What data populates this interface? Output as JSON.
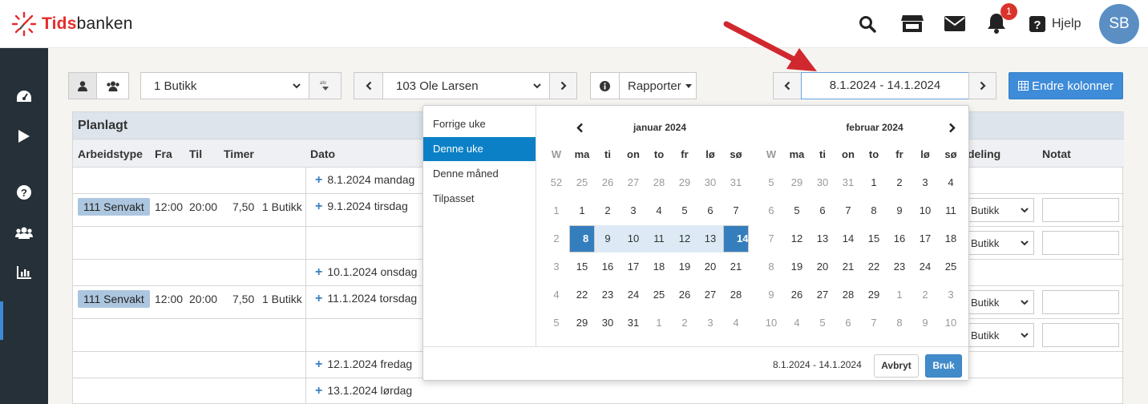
{
  "brand": {
    "name_prefix": "Tids",
    "name_suffix": "banken"
  },
  "topbar": {
    "notification_count": "1",
    "help_label": "Hjelp",
    "avatar_initials": "SB"
  },
  "toolbar": {
    "store_select": "1 Butikk",
    "employee_select": "103 Ole Larsen",
    "reports_label": "Rapporter",
    "date_range": "8.1.2024 - 14.1.2024",
    "edit_columns_label": "Endre kolonner"
  },
  "table": {
    "section_title": "Planlagt",
    "headers": {
      "worktype": "Arbeidstype",
      "from": "Fra",
      "to": "Til",
      "hours": "Timer",
      "date": "Dato",
      "department": "deling",
      "note": "Notat"
    },
    "rows": [
      {
        "date": "8.1.2024 mandag"
      },
      {
        "worktype": "111 Senvakt",
        "from": "12:00",
        "to": "20:00",
        "hours": "7,50",
        "store": "1 Butikk",
        "date": "9.1.2024 tirsdag",
        "dept": "Butikk"
      },
      {
        "dept": "Butikk"
      },
      {
        "date": "10.1.2024 onsdag"
      },
      {
        "worktype": "111 Senvakt",
        "from": "12:00",
        "to": "20:00",
        "hours": "7,50",
        "store": "1 Butikk",
        "date": "11.1.2024 torsdag",
        "dept": "Butikk"
      },
      {
        "dept": "Butikk"
      },
      {
        "date": "12.1.2024 fredag"
      },
      {
        "date": "13.1.2024 lørdag"
      }
    ]
  },
  "picker": {
    "ranges": [
      "Forrige uke",
      "Denne uke",
      "Denne måned",
      "Tilpasset"
    ],
    "active_range": "Denne uke",
    "weekday_headers": [
      "W",
      "ma",
      "ti",
      "on",
      "to",
      "fr",
      "lø",
      "sø"
    ],
    "left_month": {
      "title": "januar 2024",
      "weeks": [
        [
          "52",
          "25",
          "26",
          "27",
          "28",
          "29",
          "30",
          "31"
        ],
        [
          "1",
          "1",
          "2",
          "3",
          "4",
          "5",
          "6",
          "7"
        ],
        [
          "2",
          "8",
          "9",
          "10",
          "11",
          "12",
          "13",
          "14"
        ],
        [
          "3",
          "15",
          "16",
          "17",
          "18",
          "19",
          "20",
          "21"
        ],
        [
          "4",
          "22",
          "23",
          "24",
          "25",
          "26",
          "27",
          "28"
        ],
        [
          "5",
          "29",
          "30",
          "31",
          "1",
          "2",
          "3",
          "4"
        ]
      ]
    },
    "right_month": {
      "title": "februar 2024",
      "weeks": [
        [
          "5",
          "29",
          "30",
          "31",
          "1",
          "2",
          "3",
          "4"
        ],
        [
          "6",
          "5",
          "6",
          "7",
          "8",
          "9",
          "10",
          "11"
        ],
        [
          "7",
          "12",
          "13",
          "14",
          "15",
          "16",
          "17",
          "18"
        ],
        [
          "8",
          "19",
          "20",
          "21",
          "22",
          "23",
          "24",
          "25"
        ],
        [
          "9",
          "26",
          "27",
          "28",
          "29",
          "1",
          "2",
          "3"
        ],
        [
          "10",
          "4",
          "5",
          "6",
          "7",
          "8",
          "9",
          "10"
        ]
      ]
    },
    "footer_range": "8.1.2024 - 14.1.2024",
    "cancel_label": "Avbryt",
    "apply_label": "Bruk"
  },
  "colors": {
    "accent": "#3e8bd8",
    "sidebar": "#263039",
    "selected_day": "#357ebd",
    "in_range": "#ddeaf5",
    "annotation_arrow": "#d0282e"
  }
}
